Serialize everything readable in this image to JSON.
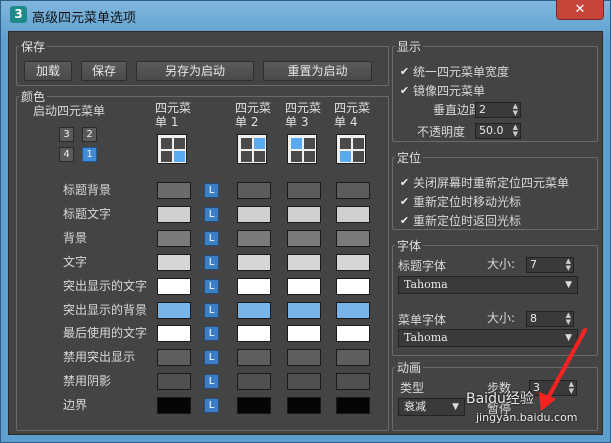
{
  "window": {
    "title": "高级四元菜单选项",
    "app_icon_text": "3",
    "close_glyph": "✕"
  },
  "save": {
    "group_title": "保存",
    "load_label": "加载",
    "save_label": "保存",
    "save_as_startup_label": "另存为启动",
    "reset_to_startup_label": "重置为启动"
  },
  "colors": {
    "group_title": "颜色",
    "startup_quad_label": "启动四元菜单",
    "quad_numbers": [
      "3",
      "2",
      "4",
      "1"
    ],
    "selected_quad": "1",
    "columns": [
      {
        "line1": "四元菜",
        "line2": "单 1"
      },
      {
        "line1": "四元菜",
        "line2": "单 2"
      },
      {
        "line1": "四元菜",
        "line2": "单 3"
      },
      {
        "line1": "四元菜",
        "line2": "单 4"
      }
    ],
    "link_label": "L",
    "rows": [
      {
        "label": "标题背景",
        "swatch": "#6b6b6b",
        "others": "#5c5c5c"
      },
      {
        "label": "标题文字",
        "swatch": "#cfcfcf",
        "others": "#cfcfcf"
      },
      {
        "label": "背景",
        "swatch": "#7a7a7a",
        "others": "#7a7a7a"
      },
      {
        "label": "文字",
        "swatch": "#d6d6d6",
        "others": "#d6d6d6"
      },
      {
        "label": "突出显示的文字",
        "swatch": "#ffffff",
        "others": "#ffffff"
      },
      {
        "label": "突出显示的背景",
        "swatch": "#78b4ea",
        "others": "#78b4ea"
      },
      {
        "label": "最后使用的文字",
        "swatch": "#ffffff",
        "others": "#ffffff"
      },
      {
        "label": "禁用突出显示",
        "swatch": "#5e5e5e",
        "others": "#5e5e5e"
      },
      {
        "label": "禁用阴影",
        "swatch": "#505050",
        "others": "#505050"
      },
      {
        "label": "边界",
        "swatch": "#050505",
        "others": "#050505"
      }
    ]
  },
  "display": {
    "group_title": "显示",
    "uniform_width_label": "统一四元菜单宽度",
    "mirror_label": "镜像四元菜单",
    "vertical_margin_label": "垂直边距",
    "vertical_margin_value": "2",
    "opacity_label": "不透明度",
    "opacity_value": "50.0"
  },
  "position": {
    "group_title": "定位",
    "reposition_label": "关闭屏幕时重新定位四元菜单",
    "move_cursor_label": "重新定位时移动光标",
    "return_cursor_label": "重新定位时返回光标"
  },
  "fonts": {
    "group_title": "字体",
    "title_font_label": "标题字体",
    "size_label": "大小:",
    "title_size": "7",
    "title_font_value": "Tahoma",
    "menu_font_label": "菜单字体",
    "menu_size": "8",
    "menu_font_value": "Tahoma"
  },
  "animation": {
    "group_title": "动画",
    "type_label": "类型",
    "steps_label": "步数",
    "steps_value": "3",
    "type_value": "衰减",
    "pause_label": "暂停"
  },
  "watermark": {
    "text": "Baidu经验",
    "url": "jingyan.baidu.com"
  },
  "accent": {
    "selection": "#3e8ad6",
    "annotation_arrow": "#ff2020"
  }
}
